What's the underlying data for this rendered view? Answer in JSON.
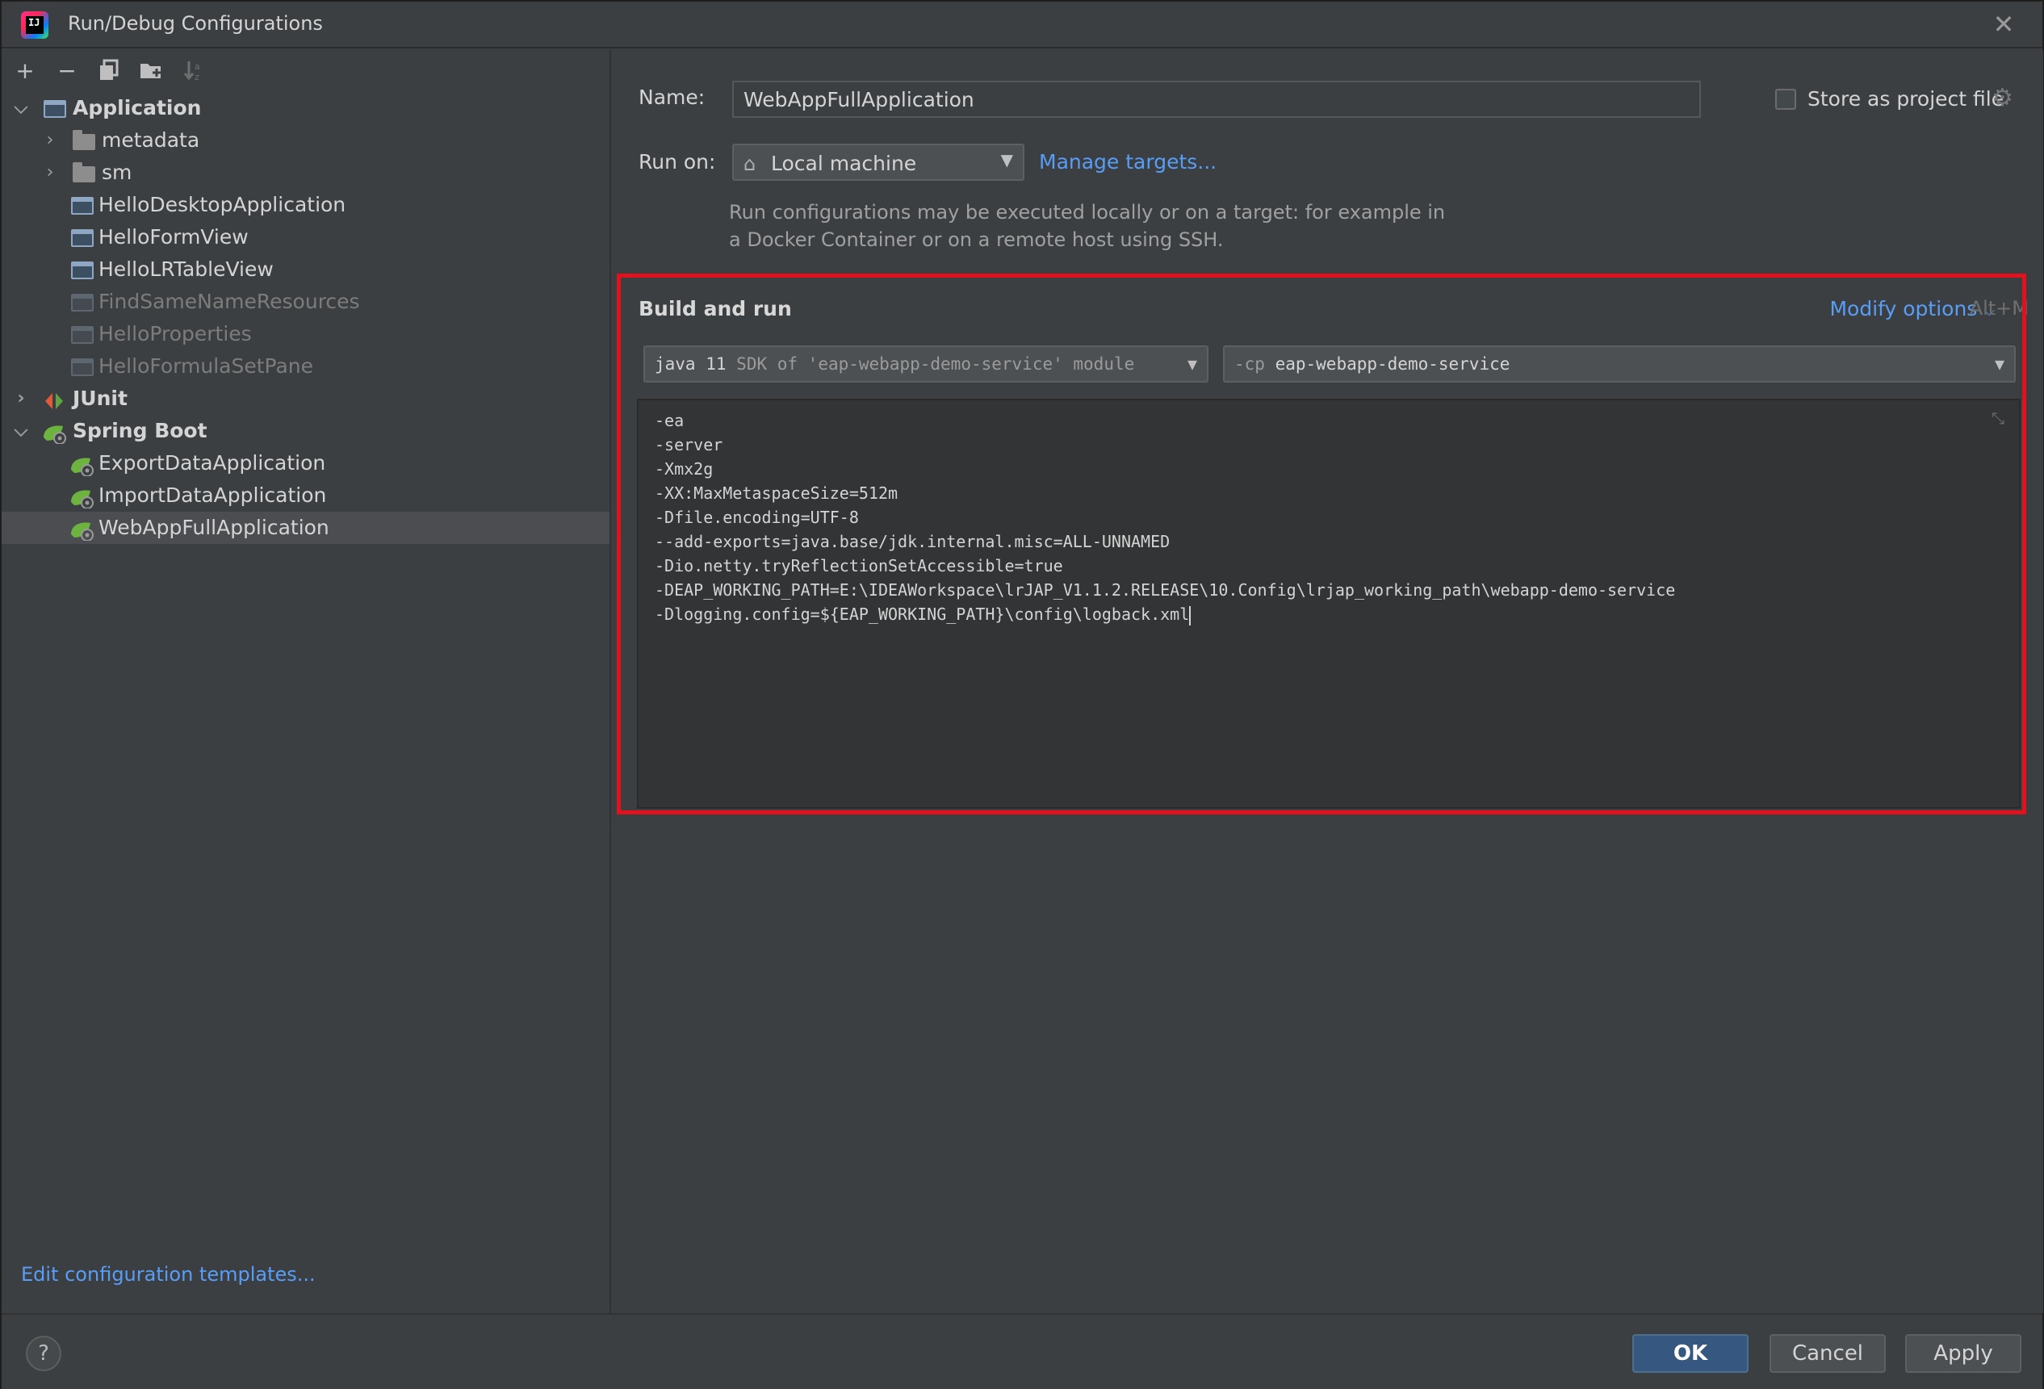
{
  "window": {
    "title": "Run/Debug Configurations"
  },
  "toolbar": {
    "buttons": [
      "add",
      "remove",
      "copy",
      "new-folder",
      "sort"
    ]
  },
  "tree": {
    "application": "Application",
    "metadata": "metadata",
    "sm": "sm",
    "hello_desktop": "HelloDesktopApplication",
    "hello_form_view": "HelloFormView",
    "hello_lr_table_view": "HelloLRTableView",
    "find_same_name": "FindSameNameResources",
    "hello_properties": "HelloProperties",
    "hello_formula": "HelloFormulaSetPane",
    "junit": "JUnit",
    "spring_boot": "Spring Boot",
    "export_data": "ExportDataApplication",
    "import_data": "ImportDataApplication",
    "webapp_full": "WebAppFullApplication"
  },
  "left_footer": {
    "edit_templates": "Edit configuration templates..."
  },
  "form": {
    "name_label": "Name:",
    "name_value": "WebAppFullApplication",
    "store_label": "Store as project file",
    "run_on_label": "Run on:",
    "run_on_value": "Local machine",
    "manage_targets": "Manage targets...",
    "hint": "Run configurations may be executed locally or on a target: for example in a Docker Container or on a remote host using SSH."
  },
  "build_run": {
    "title": "Build and run",
    "modify_options": "Modify options",
    "shortcut": "Alt+M",
    "jdk_main": "java 11",
    "jdk_sub": "SDK of 'eap-webapp-demo-service' module",
    "cp_flag": "-cp",
    "cp_value": "eap-webapp-demo-service",
    "vm_options": "-ea\n-server\n-Xmx2g\n-XX:MaxMetaspaceSize=512m\n-Dfile.encoding=UTF-8\n--add-exports=java.base/jdk.internal.misc=ALL-UNNAMED\n-Dio.netty.tryReflectionSetAccessible=true\n-DEAP_WORKING_PATH=E:\\IDEAWorkspace\\lrJAP_V1.1.2.RELEASE\\10.Config\\lrjap_working_path\\webapp-demo-service\n-Dlogging.config=${EAP_WORKING_PATH}\\config\\logback.xml"
  },
  "buttons": {
    "help": "?",
    "ok": "OK",
    "cancel": "Cancel",
    "apply": "Apply"
  },
  "colors": {
    "background": "#3c3f41",
    "link": "#589df6",
    "highlight_border": "#e5101d",
    "ok_button": "#365880",
    "selection": "#4b4d50"
  }
}
